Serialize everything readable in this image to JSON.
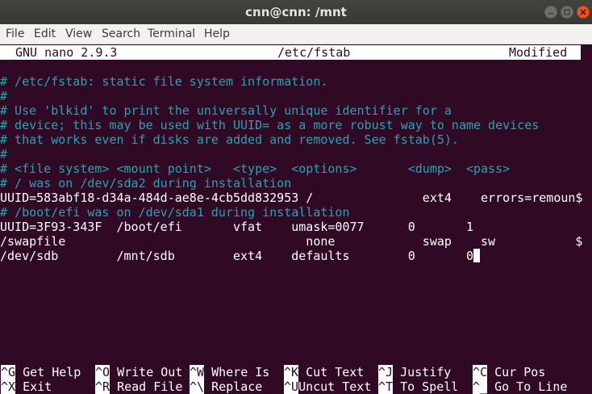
{
  "window": {
    "title": "cnn@cnn: /mnt"
  },
  "menu": [
    "File",
    "Edit",
    "View",
    "Search",
    "Terminal",
    "Help"
  ],
  "nano": {
    "version": "GNU nano 2.9.3",
    "filename": "/etc/fstab",
    "status": "Modified"
  },
  "file_lines": [
    "# /etc/fstab: static file system information.",
    "#",
    "# Use 'blkid' to print the universally unique identifier for a",
    "# device; this may be used with UUID= as a more robust way to name devices",
    "# that works even if disks are added and removed. See fstab(5).",
    "#",
    "# <file system> <mount point>   <type>  <options>       <dump>  <pass>",
    "# / was on /dev/sda2 during installation",
    "UUID=583abf18-d34a-484d-ae8e-4cb5dd832953 /               ext4    errors=remoun$",
    "# /boot/efi was on /dev/sda1 during installation",
    "UUID=3F93-343F  /boot/efi       vfat    umask=0077      0       1",
    "/swapfile                                 none            swap    sw           $",
    "/dev/sdb        /mnt/sdb        ext4    defaults        0       0"
  ],
  "shortcuts": [
    [
      {
        "key": "^G",
        "label": "Get Help"
      },
      {
        "key": "^O",
        "label": "Write Out"
      },
      {
        "key": "^W",
        "label": "Where Is"
      },
      {
        "key": "^K",
        "label": "Cut Text"
      },
      {
        "key": "^J",
        "label": "Justify"
      },
      {
        "key": "^C",
        "label": "Cur Pos"
      }
    ],
    [
      {
        "key": "^X",
        "label": "Exit"
      },
      {
        "key": "^R",
        "label": "Read File"
      },
      {
        "key": "^\\",
        "label": "Replace"
      },
      {
        "key": "^U",
        "label": "Uncut Text"
      },
      {
        "key": "^T",
        "label": "To Spell"
      },
      {
        "key": "^_",
        "label": "Go To Line"
      }
    ]
  ]
}
